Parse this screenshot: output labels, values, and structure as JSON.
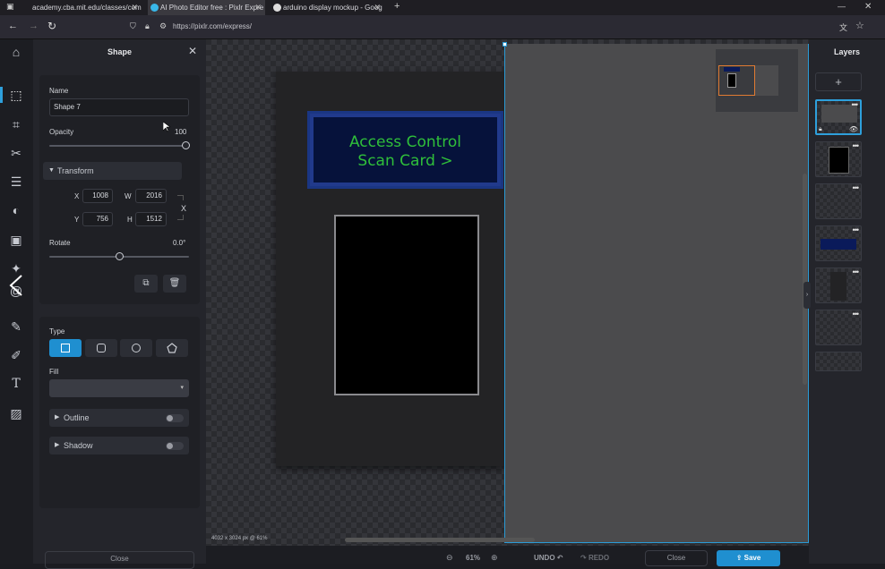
{
  "browser": {
    "tabs": [
      {
        "label": "academy.cba.mit.edu/classes/comp",
        "active": false
      },
      {
        "label": "AI Photo Editor free : Pixlr Expre",
        "active": true
      },
      {
        "label": "arduino display mockup - Goog",
        "active": false
      }
    ],
    "new_tab": "+",
    "url": "https://pixlr.com/express/"
  },
  "icons": {
    "rail": [
      "home-icon",
      "arrange-icon",
      "crop-icon",
      "cut-icon",
      "adjust-icon",
      "filter-icon",
      "effect-icon",
      "ai-sparkle-icon",
      "liquify-icon",
      "heal-icon",
      "brush-icon",
      "text-icon",
      "pattern-icon"
    ]
  },
  "panel": {
    "title": "Shape",
    "close_glyph": "✕",
    "name_label": "Name",
    "name_value": "Shape 7",
    "opacity_label": "Opacity",
    "opacity_value": "100",
    "opacity_level": 1.0,
    "transform_label": "Transform",
    "x_label": "X",
    "x_value": "1008",
    "w_label": "W",
    "w_value": "2016",
    "y_label": "Y",
    "y_value": "756",
    "h_label": "H",
    "h_value": "1512",
    "lock_glyph": "X",
    "rotate_label": "Rotate",
    "rotate_value": "0.0°",
    "rotate_level": 0.5,
    "type_label": "Type",
    "fill_label": "Fill",
    "outline_label": "Outline",
    "shadow_label": "Shadow",
    "close_button": "Close"
  },
  "canvas": {
    "banner_line1": "Access Control",
    "banner_line2": "Scan Card >",
    "info": "4032 x 3024 px @ 61%"
  },
  "bottom": {
    "zoom_value": "61%",
    "undo_label": "UNDO",
    "redo_label": "REDO",
    "close_label": "Close",
    "save_label": "Save"
  },
  "layers": {
    "title": "Layers",
    "add_glyph": "+",
    "dots": "•••"
  },
  "colors": {
    "accent": "#1f8fd0",
    "banner_text": "#2fbf3a",
    "banner_bg": "#06123b",
    "banner_border": "#213a8c"
  }
}
